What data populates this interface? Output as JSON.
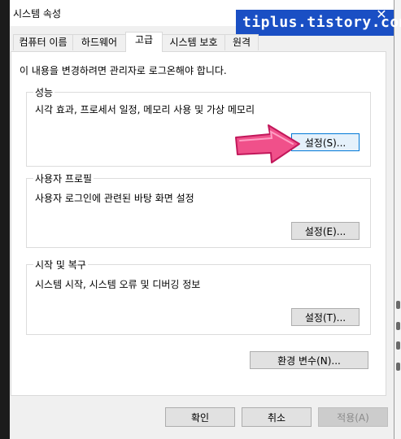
{
  "window": {
    "title": "시스템 속성",
    "watermark": "tiplus.tistory.com",
    "close_glyph": "✕"
  },
  "tabs": [
    {
      "label": "컴퓨터 이름"
    },
    {
      "label": "하드웨어"
    },
    {
      "label": "고급",
      "active": true
    },
    {
      "label": "시스템 보호"
    },
    {
      "label": "원격"
    }
  ],
  "advanced": {
    "admin_note": "이 내용을 변경하려면 관리자로 로그온해야 합니다.",
    "performance": {
      "title": "성능",
      "description": "시각 효과, 프로세서 일정, 메모리 사용 및 가상 메모리",
      "button": "설정(S)..."
    },
    "user_profiles": {
      "title": "사용자 프로필",
      "description": "사용자 로그인에 관련된 바탕 화면 설정",
      "button": "설정(E)..."
    },
    "startup_recovery": {
      "title": "시작 및 복구",
      "description": "시스템 시작, 시스템 오류 및 디버깅 정보",
      "button": "설정(T)..."
    },
    "env_button": "환경 변수(N)..."
  },
  "footer": {
    "ok": "확인",
    "cancel": "취소",
    "apply": "적용(A)"
  },
  "annotation": {
    "arrow_icon": "pink-pointer-arrow-icon",
    "arrow_color": "#f0508a"
  }
}
